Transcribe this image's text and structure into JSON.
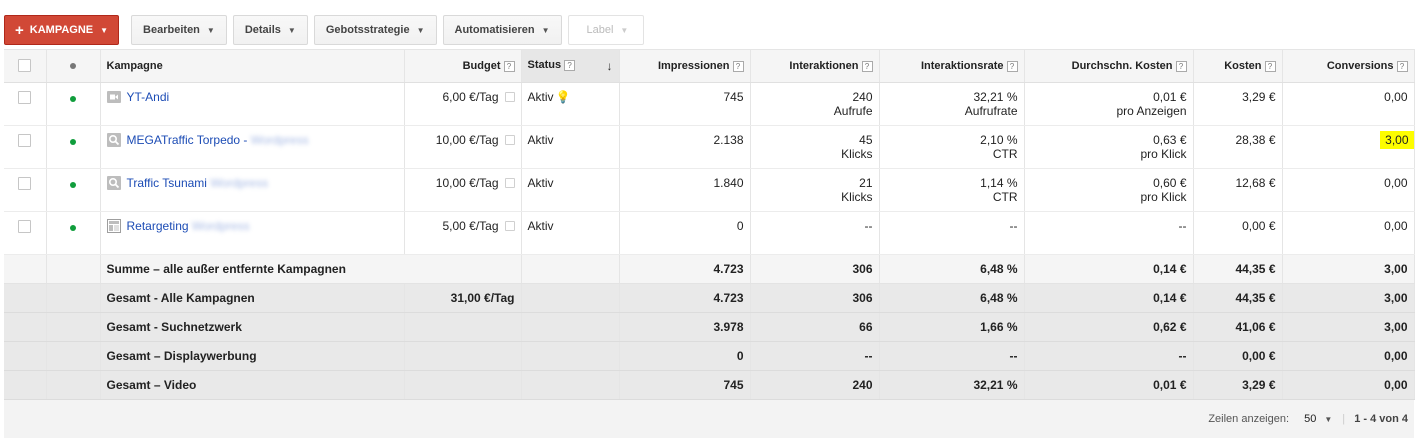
{
  "toolbar": {
    "new_campaign": "KAMPAGNE",
    "edit": "Bearbeiten",
    "details": "Details",
    "bid_strategy": "Gebotsstrategie",
    "automate": "Automatisieren",
    "label": "Label"
  },
  "columns": {
    "campaign": "Kampagne",
    "budget": "Budget",
    "status": "Status",
    "impressions": "Impressionen",
    "interactions": "Interaktionen",
    "interaction_rate": "Interaktionsrate",
    "avg_cost": "Durchschn. Kosten",
    "cost": "Kosten",
    "conversions": "Conversions",
    "help": "?"
  },
  "campaigns": [
    {
      "name": "YT-Andi",
      "suffix": "",
      "type_icon": "video-icon",
      "budget": "6,00 €/Tag",
      "status": "Aktiv",
      "impressions": "745",
      "interactions": "240",
      "interactions_unit": "Aufrufe",
      "rate": "32,21 %",
      "rate_unit": "Aufrufrate",
      "avg_cost": "0,01 €",
      "avg_cost_unit": "pro Anzeigen",
      "cost": "3,29 €",
      "conversions": "0,00"
    },
    {
      "name": "MEGATraffic Torpedo - ",
      "suffix": "Wordpress",
      "type_icon": "search-icon",
      "budget": "10,00 €/Tag",
      "status": "Aktiv",
      "impressions": "2.138",
      "interactions": "45",
      "interactions_unit": "Klicks",
      "rate": "2,10 %",
      "rate_unit": "CTR",
      "avg_cost": "0,63 €",
      "avg_cost_unit": "pro Klick",
      "cost": "28,38 €",
      "conversions": "3,00"
    },
    {
      "name": "Traffic Tsunami ",
      "suffix": "Wordpress",
      "type_icon": "search-icon",
      "budget": "10,00 €/Tag",
      "status": "Aktiv",
      "impressions": "1.840",
      "interactions": "21",
      "interactions_unit": "Klicks",
      "rate": "1,14 %",
      "rate_unit": "CTR",
      "avg_cost": "0,60 €",
      "avg_cost_unit": "pro Klick",
      "cost": "12,68 €",
      "conversions": "0,00"
    },
    {
      "name": "Retargeting ",
      "suffix": "Wordpress",
      "type_icon": "display-icon",
      "budget": "5,00 €/Tag",
      "status": "Aktiv",
      "impressions": "0",
      "interactions": "--",
      "interactions_unit": "",
      "rate": "--",
      "rate_unit": "",
      "avg_cost": "--",
      "avg_cost_unit": "",
      "cost": "0,00 €",
      "conversions": "0,00"
    }
  ],
  "totals": [
    {
      "label": "Summe – alle außer entfernte Kampagnen",
      "budget": "",
      "impressions": "4.723",
      "interactions": "306",
      "rate": "6,48 %",
      "avg_cost": "0,14 €",
      "cost": "44,35 €",
      "conversions": "3,00"
    },
    {
      "label": "Gesamt - Alle Kampagnen",
      "budget": "31,00 €/Tag",
      "impressions": "4.723",
      "interactions": "306",
      "rate": "6,48 %",
      "avg_cost": "0,14 €",
      "cost": "44,35 €",
      "conversions": "3,00"
    },
    {
      "label": "Gesamt - Suchnetzwerk",
      "budget": "",
      "impressions": "3.978",
      "interactions": "66",
      "rate": "1,66 %",
      "avg_cost": "0,62 €",
      "cost": "41,06 €",
      "conversions": "3,00"
    },
    {
      "label": "Gesamt – Displaywerbung",
      "budget": "",
      "impressions": "0",
      "interactions": "--",
      "rate": "--",
      "avg_cost": "--",
      "cost": "0,00 €",
      "conversions": "0,00"
    },
    {
      "label": "Gesamt – Video",
      "budget": "",
      "impressions": "745",
      "interactions": "240",
      "rate": "32,21 %",
      "avg_cost": "0,01 €",
      "cost": "3,29 €",
      "conversions": "0,00"
    }
  ],
  "pagination": {
    "rows_label": "Zeilen anzeigen:",
    "rows_value": "50",
    "range": "1 - 4 von 4"
  },
  "colors": {
    "primary_button": "#d14836",
    "link": "#1c4cb5",
    "status_dot": "#109d3c",
    "highlight": "#fdfd00"
  }
}
